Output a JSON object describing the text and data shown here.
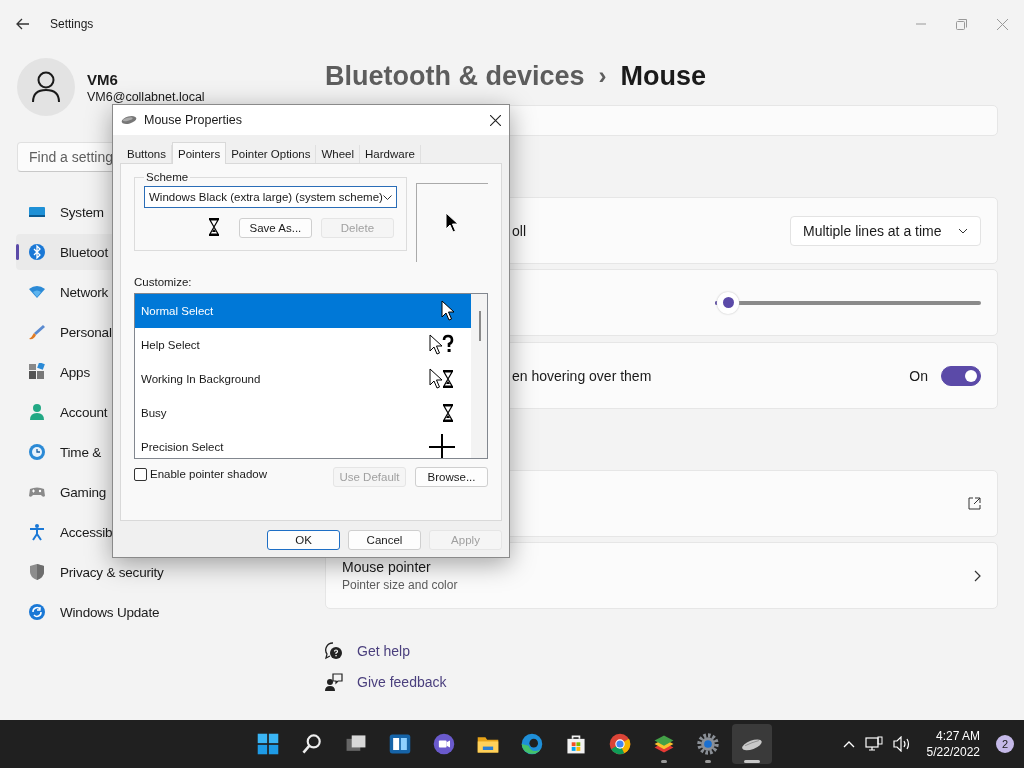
{
  "settings_window": {
    "title": "Settings"
  },
  "profile": {
    "name": "VM6",
    "email": "VM6@collabnet.local"
  },
  "search": {
    "placeholder": "Find a setting"
  },
  "sidebar": {
    "items": [
      {
        "label": "System",
        "selected": false
      },
      {
        "label": "Bluetoot",
        "selected": true
      },
      {
        "label": "Network",
        "selected": false
      },
      {
        "label": "Personal",
        "selected": false
      },
      {
        "label": "Apps",
        "selected": false
      },
      {
        "label": "Account",
        "selected": false
      },
      {
        "label": "Time &",
        "selected": false
      },
      {
        "label": "Gaming",
        "selected": false
      },
      {
        "label": "Accessib",
        "selected": false
      },
      {
        "label": "Privacy & security",
        "selected": false
      },
      {
        "label": "Windows Update",
        "selected": false
      }
    ]
  },
  "page": {
    "breadcrumb": "Bluetooth & devices",
    "separator": "›",
    "title": "Mouse"
  },
  "cards": [
    {
      "kind": "blank"
    },
    {
      "kind": "dropdown",
      "label": "oll",
      "value": "Multiple lines at a time"
    },
    {
      "kind": "slider",
      "level": 0.05
    },
    {
      "kind": "toggle",
      "label": "en hovering over them",
      "state_text": "On",
      "on": true
    },
    {
      "kind": "link"
    },
    {
      "kind": "nav",
      "title": "Mouse pointer",
      "subtitle": "Pointer size and color"
    }
  ],
  "help_links": [
    {
      "label": "Get help"
    },
    {
      "label": "Give feedback"
    }
  ],
  "dialog": {
    "title": "Mouse Properties",
    "tabs": [
      {
        "label": "Buttons",
        "selected": false
      },
      {
        "label": "Pointers",
        "selected": true
      },
      {
        "label": "Pointer Options",
        "selected": false
      },
      {
        "label": "Wheel",
        "selected": false
      },
      {
        "label": "Hardware",
        "selected": false
      }
    ],
    "scheme": {
      "label": "Scheme",
      "value": "Windows Black (extra large) (system scheme)",
      "buttons": [
        {
          "label": "Save As...",
          "disabled": false
        },
        {
          "label": "Delete",
          "disabled": true
        }
      ]
    },
    "customize_label": "Customize:",
    "cursors": [
      {
        "kind": "arrow",
        "label": "Normal Select",
        "selected": true
      },
      {
        "kind": "help",
        "label": "Help Select",
        "selected": false
      },
      {
        "kind": "working",
        "label": "Working In Background",
        "selected": false
      },
      {
        "kind": "busy",
        "label": "Busy",
        "selected": false
      },
      {
        "kind": "crosshair",
        "label": "Precision Select",
        "selected": false
      }
    ],
    "shadow": {
      "label": "Enable pointer shadow",
      "checked": false
    },
    "list_buttons": [
      {
        "label": "Use Default",
        "disabled": true
      },
      {
        "label": "Browse...",
        "disabled": false
      }
    ],
    "buttons": [
      {
        "label": "OK",
        "default": true,
        "disabled": false
      },
      {
        "label": "Cancel",
        "default": false,
        "disabled": false
      },
      {
        "label": "Apply",
        "default": false,
        "disabled": true
      }
    ]
  },
  "taskbar": {
    "apps": [
      {
        "kind": "start",
        "running": false,
        "active": false
      },
      {
        "kind": "search",
        "running": false,
        "active": false
      },
      {
        "kind": "taskview",
        "running": false,
        "active": false
      },
      {
        "kind": "widgets",
        "running": false,
        "active": false
      },
      {
        "kind": "chat",
        "running": false,
        "active": false
      },
      {
        "kind": "explorer",
        "running": false,
        "active": false
      },
      {
        "kind": "edge",
        "running": false,
        "active": false
      },
      {
        "kind": "store",
        "running": false,
        "active": false
      },
      {
        "kind": "chrome",
        "running": false,
        "active": false
      },
      {
        "kind": "bluestacks",
        "running": true,
        "active": false
      },
      {
        "kind": "settings",
        "running": true,
        "active": false
      },
      {
        "kind": "mouse",
        "running": true,
        "active": true
      }
    ],
    "clock": {
      "time": "4:27 AM",
      "date": "5/22/2022"
    },
    "notifications": "2"
  }
}
